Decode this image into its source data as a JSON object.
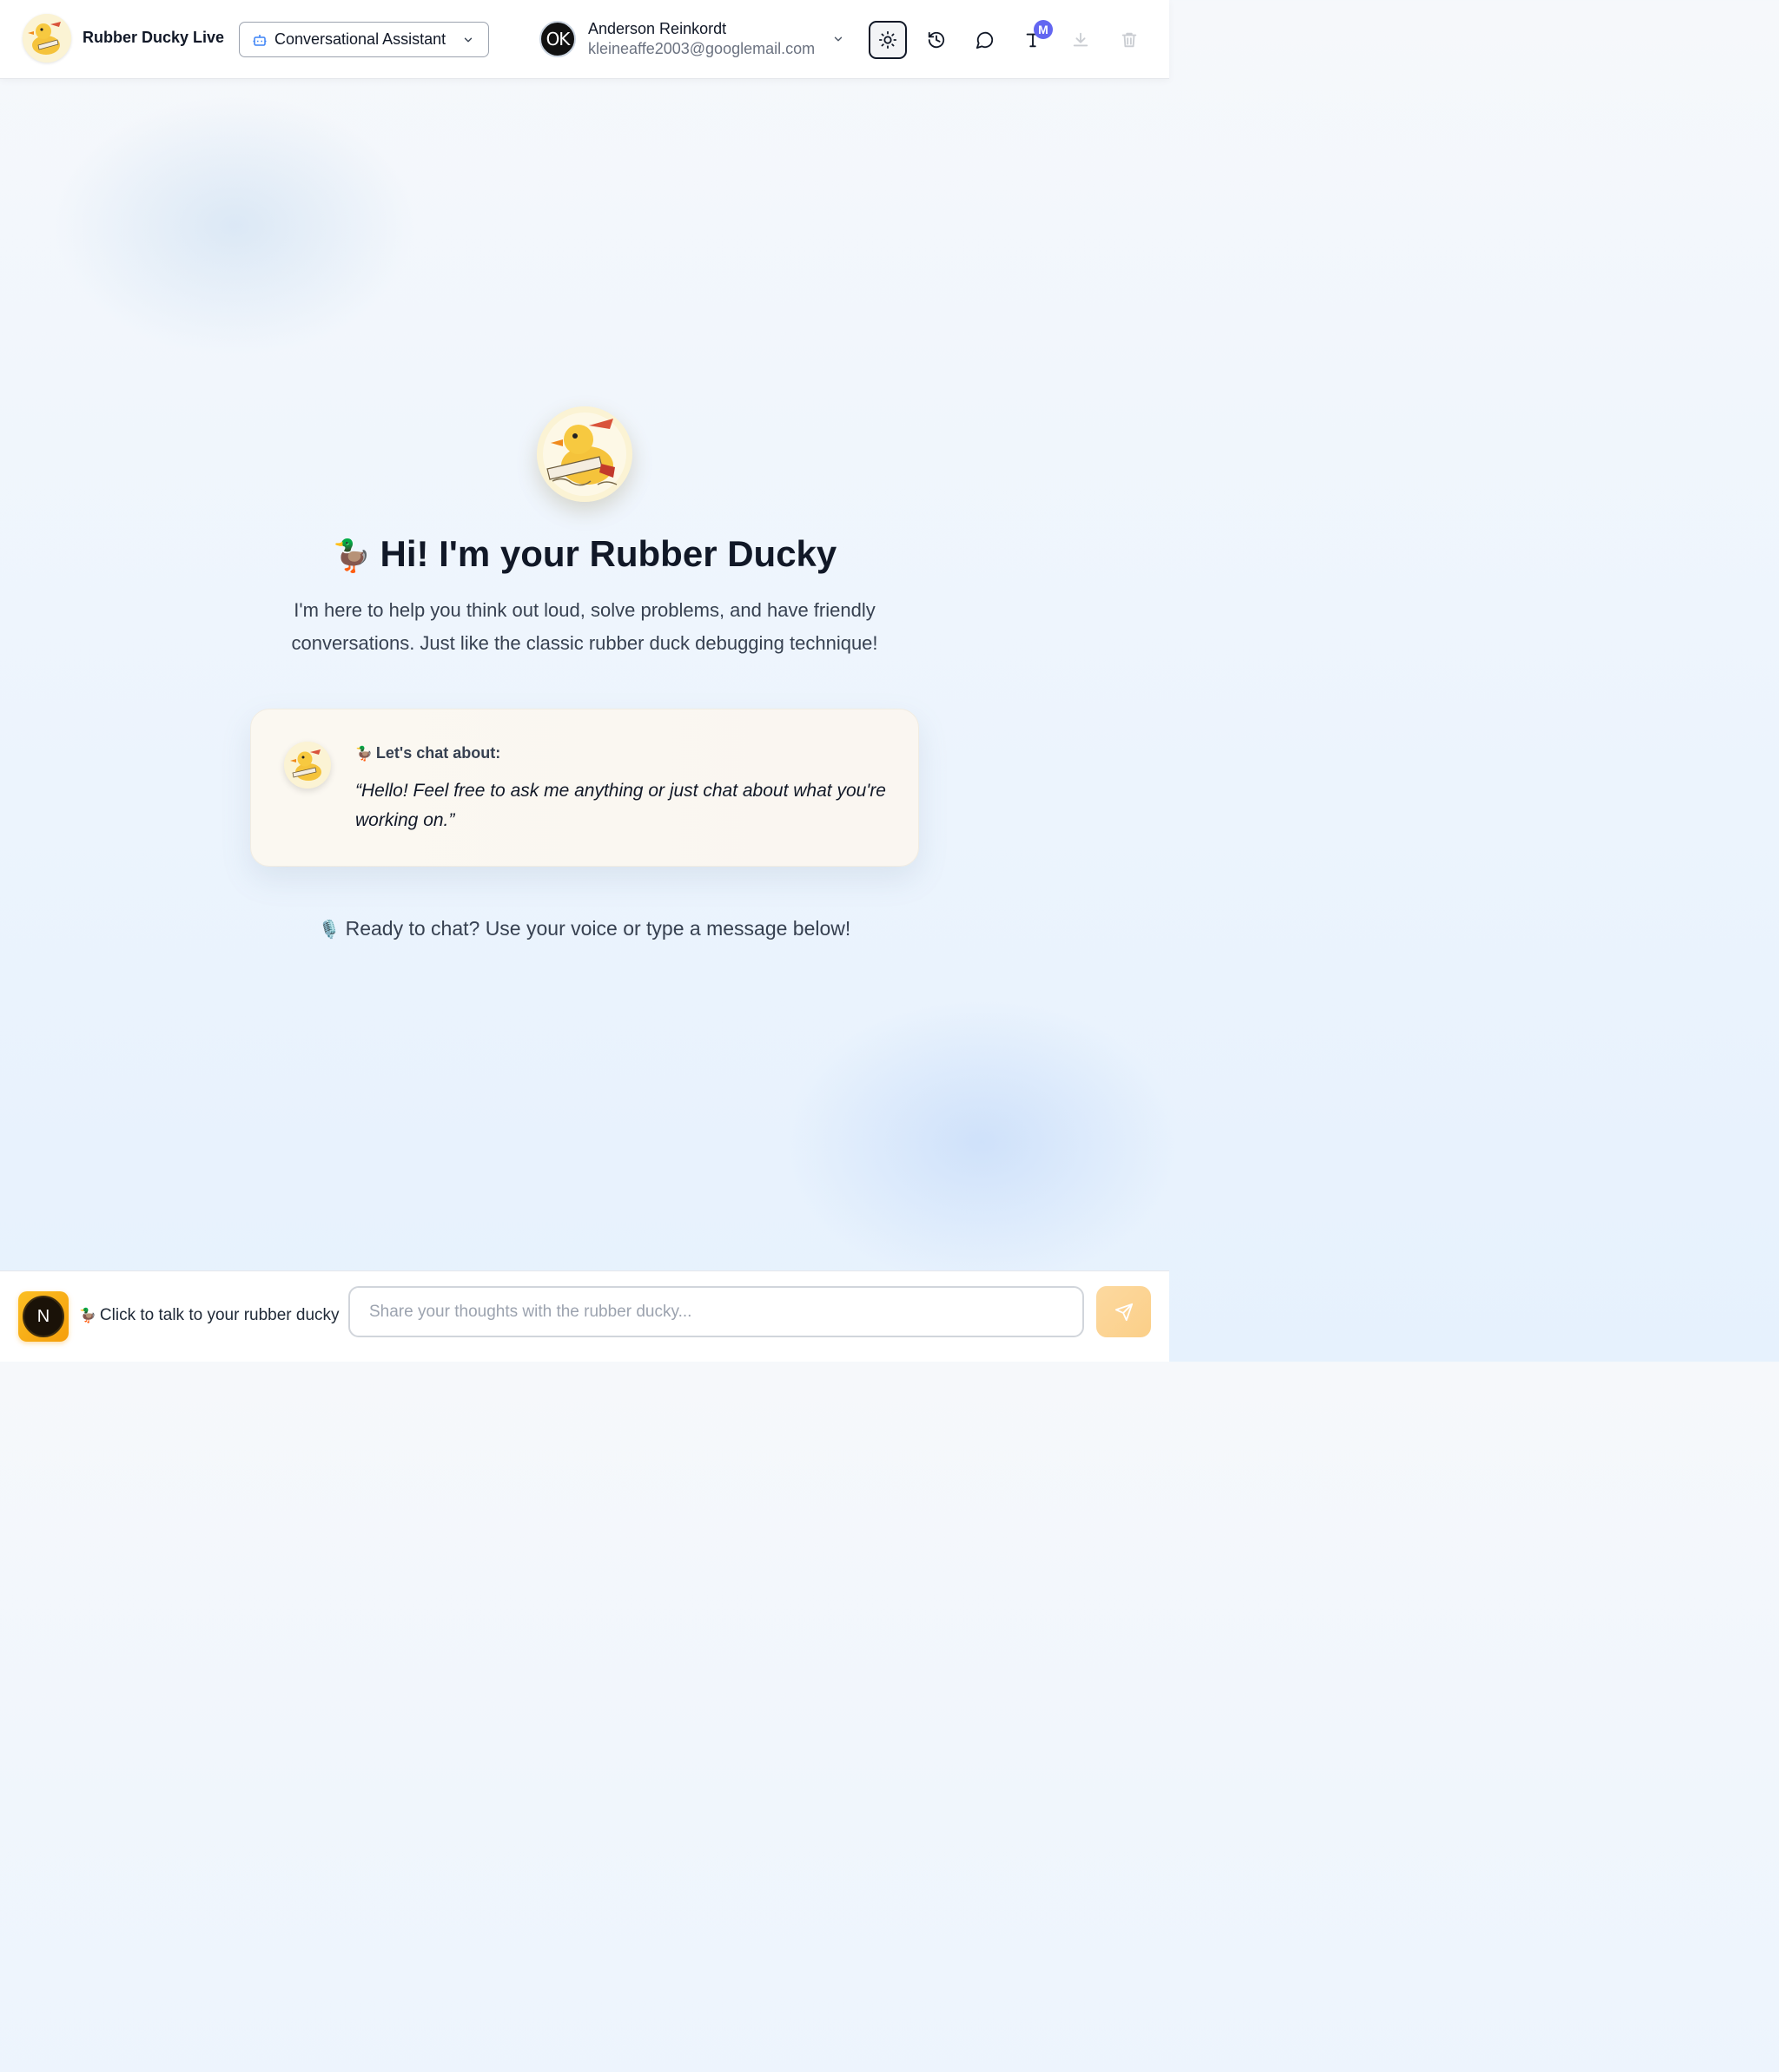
{
  "app": {
    "title": "Rubber Ducky Live",
    "logo_icon": "rubber-duck-logo"
  },
  "header": {
    "mode_select": {
      "icon": "bot-icon",
      "label": "Conversational Assistant"
    },
    "user": {
      "avatar_initials": "OK",
      "name": "Anderson Reinkordt",
      "email": "kleineaffe2003@googlemail.com"
    },
    "actions": [
      {
        "icon": "sun-icon",
        "active": true
      },
      {
        "icon": "history-icon",
        "active": false
      },
      {
        "icon": "chat-bubble-icon",
        "active": false
      },
      {
        "icon": "text-size-icon",
        "badge": "M"
      },
      {
        "icon": "download-icon",
        "disabled": true
      },
      {
        "icon": "trash-icon",
        "disabled": true
      }
    ]
  },
  "hero": {
    "emoji": "🦆",
    "title": "Hi! I'm your Rubber Ducky",
    "subtitle": "I'm here to help you think out loud, solve problems, and have friendly conversations. Just like the classic rubber duck debugging technique!"
  },
  "prompt_card": {
    "emoji": "🦆",
    "label": "Let's chat about:",
    "quote": "“Hello! Feel free to ask me anything or just chat about what you're working on.”"
  },
  "ready": {
    "emoji": "🎙️",
    "text": "Ready to chat? Use your voice or type a message below!"
  },
  "footer": {
    "voice_button_letter": "N",
    "voice_hint_emoji": "🦆",
    "voice_hint": "Click to talk to your rubber ducky",
    "input_placeholder": "Share your thoughts with the rubber ducky...",
    "input_value": "",
    "send_icon": "send-icon"
  },
  "colors": {
    "accent": "#f59e0b",
    "badge": "#6366f1",
    "text_primary": "#111827",
    "text_secondary": "#374151"
  }
}
